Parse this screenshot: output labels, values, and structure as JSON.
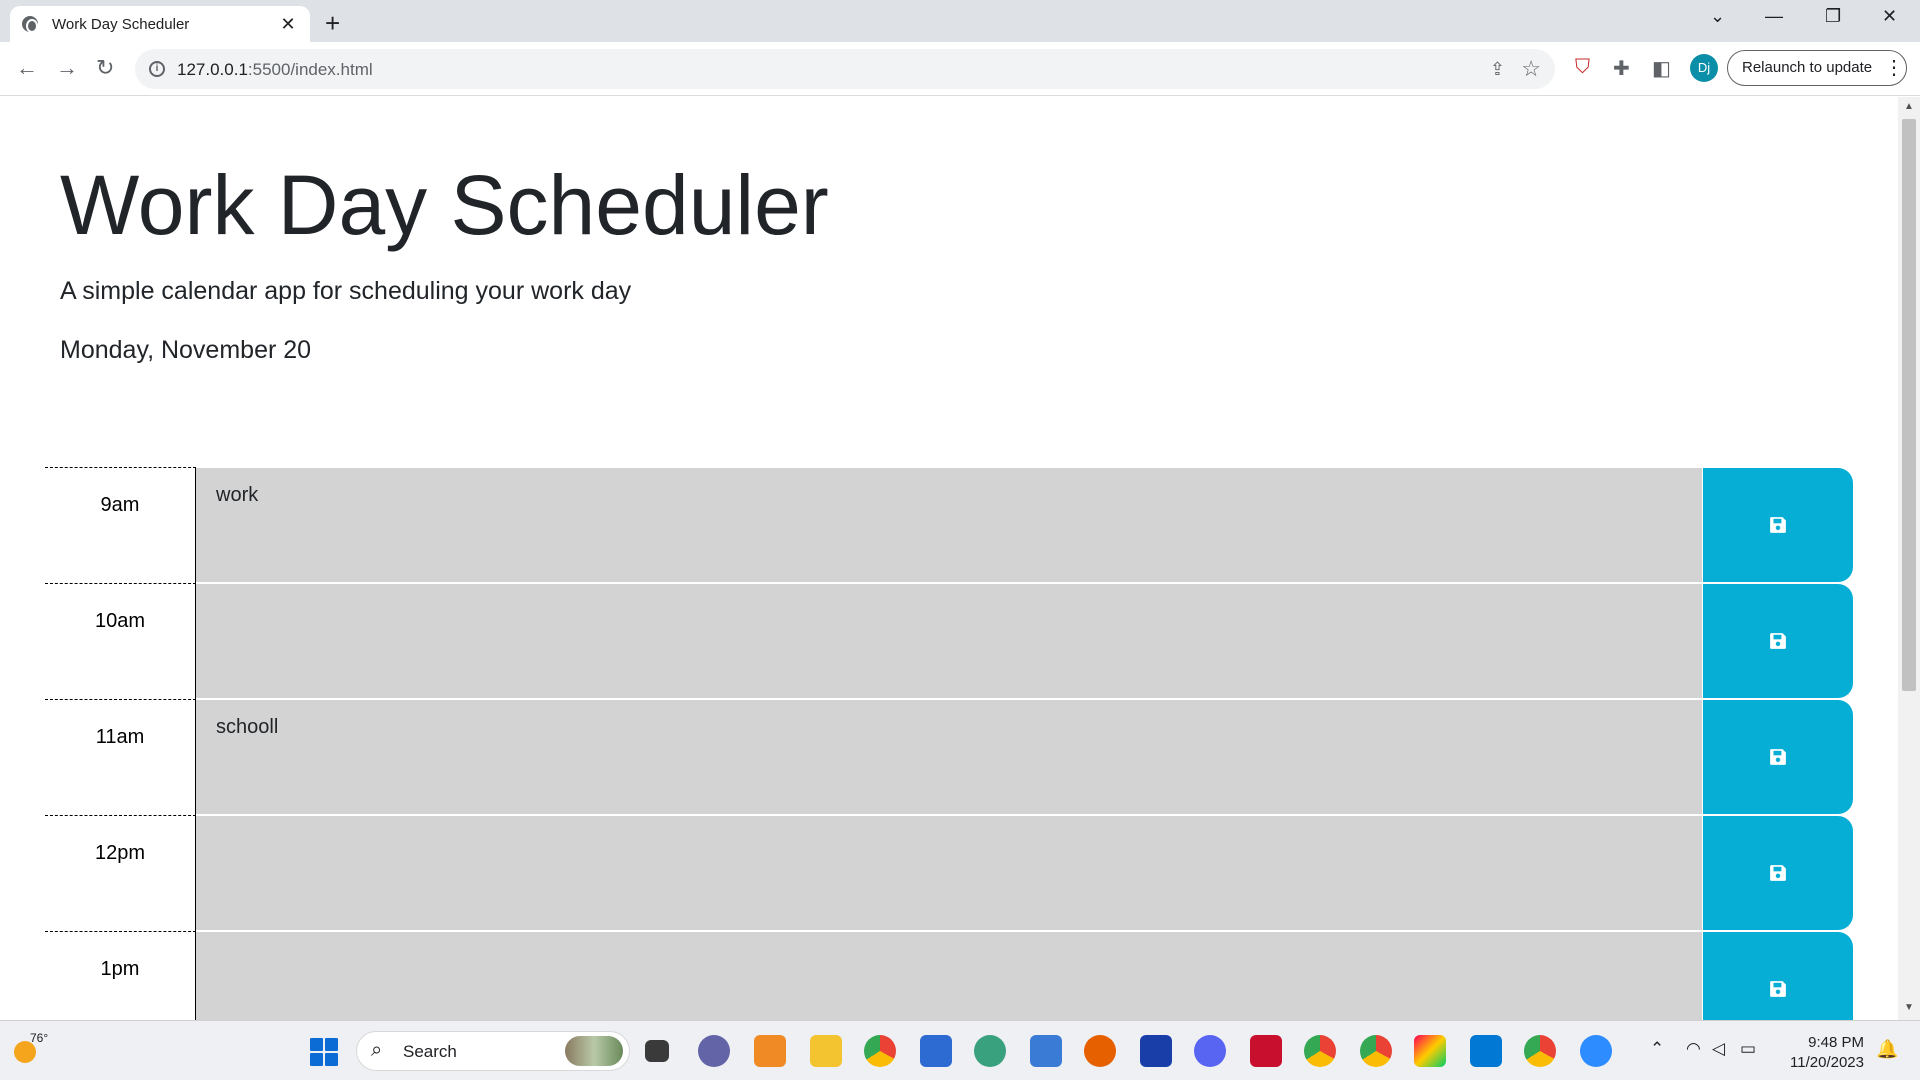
{
  "browser": {
    "tab_title": "Work Day Scheduler",
    "tab_close": "✕",
    "new_tab": "+",
    "url_host": "127.0.0.1",
    "url_rest": ":5500/index.html",
    "relaunch_label": "Relaunch to update",
    "profile_initials": "Dj"
  },
  "page": {
    "title": "Work Day Scheduler",
    "lead": "A simple calendar app for scheduling your work day",
    "current_day": "Monday, November 20",
    "time_blocks": [
      {
        "hour": "9am",
        "text": "work"
      },
      {
        "hour": "10am",
        "text": ""
      },
      {
        "hour": "11am",
        "text": "schooll"
      },
      {
        "hour": "12pm",
        "text": ""
      },
      {
        "hour": "1pm",
        "text": ""
      }
    ],
    "save_color": "#06aed5",
    "block_color": "#d3d3d3"
  },
  "taskbar": {
    "weather_temp": "76°",
    "search_label": "Search",
    "time": "9:48 PM",
    "date": "11/20/2023"
  }
}
